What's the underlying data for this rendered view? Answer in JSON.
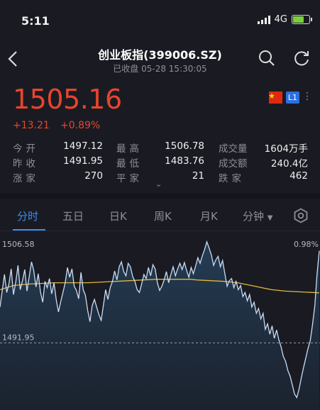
{
  "status": {
    "time": "5:11",
    "network": "4G"
  },
  "header": {
    "title": "创业板指(399006.SZ)",
    "subtitle": "已收盘 05-28 15:30:05"
  },
  "quote": {
    "price": "1505.16",
    "change": "+13.21",
    "change_pct": "+0.89%",
    "market_badge": "L1"
  },
  "stats": [
    [
      {
        "label": "今开",
        "value": "1497.12"
      },
      {
        "label": "最高",
        "value": "1506.78"
      },
      {
        "label": "成交量",
        "value": "1604万手"
      }
    ],
    [
      {
        "label": "昨收",
        "value": "1491.95"
      },
      {
        "label": "最低",
        "value": "1483.76"
      },
      {
        "label": "成交额",
        "value": "240.4亿"
      }
    ],
    [
      {
        "label": "涨家",
        "value": "270"
      },
      {
        "label": "平家",
        "value": "21"
      },
      {
        "label": "跌家",
        "value": "462"
      }
    ]
  ],
  "tabs": [
    "分时",
    "五日",
    "日K",
    "周K",
    "月K",
    "分钟"
  ],
  "active_tab": "分时",
  "chart": {
    "top_label": "1506.58",
    "top_pct": "0.98%",
    "ref_label": "1491.95"
  },
  "chart_data": {
    "type": "line",
    "series": [
      {
        "values": [
          1497.1,
          1499.5,
          1501.8,
          1499.2,
          1500.5,
          1502.6,
          1498.9,
          1500.7,
          1503.1,
          1499.6,
          1500.9,
          1502.5,
          1499.4,
          1501.5,
          1503.6,
          1502.4,
          1500.0,
          1501.9,
          1499.3,
          1497.8,
          1500.8,
          1499.9,
          1501.2,
          1499.0,
          1500.6,
          1498.2,
          1496.4,
          1497.9,
          1499.2,
          1500.6,
          1502.8,
          1501.4,
          1502.6,
          1500.1,
          1499.5,
          1498.3,
          1502.1,
          1499.6,
          1498.8,
          1496.6,
          1495.0,
          1497.3,
          1498.2,
          1497.1,
          1496.0,
          1495.2,
          1497.4,
          1499.6,
          1498.2,
          1499.9,
          1500.8,
          1502.3,
          1501.0,
          1502.9,
          1503.6,
          1502.2,
          1501.6,
          1503.4,
          1502.9,
          1501.5,
          1500.8,
          1499.6,
          1499.2,
          1500.4,
          1501.8,
          1501.2,
          1502.8,
          1501.6,
          1503.2,
          1502.6,
          1500.6,
          1499.5,
          1500.1,
          1501.0,
          1502.2,
          1500.6,
          1501.8,
          1502.9,
          1501.6,
          1502.6,
          1503.4,
          1502.5,
          1503.5,
          1502.4,
          1501.4,
          1502.8,
          1501.9,
          1503.0,
          1504.2,
          1503.4,
          1504.5,
          1505.4,
          1506.5,
          1505.6,
          1504.6,
          1503.1,
          1503.9,
          1504.4,
          1502.9,
          1503.8,
          1501.9,
          1500.1,
          1500.9,
          1501.2,
          1499.9,
          1500.8,
          1499.6,
          1500.2,
          1498.6,
          1499.2,
          1498.0,
          1498.9,
          1497.1,
          1497.8,
          1496.2,
          1496.9,
          1495.4,
          1496.2,
          1493.9,
          1494.7,
          1493.2,
          1494.4,
          1492.6,
          1493.8,
          1492.4,
          1491.4,
          1490.0,
          1489.3,
          1488.0,
          1487.2,
          1485.9,
          1484.6,
          1484.1,
          1485.3,
          1486.9,
          1488.4,
          1489.8,
          1491.2,
          1492.3,
          1494.6,
          1497.3,
          1501.8,
          1505.2
        ]
      },
      {
        "values": [
          1499.6,
          1499.9,
          1500.2,
          1500.3,
          1500.4,
          1500.45,
          1500.5,
          1500.55,
          1500.6,
          1500.6,
          1500.6,
          1500.6,
          1500.6,
          1500.6,
          1500.65,
          1500.7,
          1500.75,
          1500.8,
          1500.85,
          1500.9,
          1500.95,
          1501.0,
          1501.05,
          1501.1,
          1501.1,
          1501.1,
          1501.1,
          1501.1,
          1501.1,
          1501.0,
          1500.95,
          1500.9,
          1500.85,
          1500.8,
          1500.7,
          1500.6,
          1500.4,
          1500.2,
          1500.0,
          1499.8,
          1499.6,
          1499.5,
          1499.4,
          1499.35,
          1499.3,
          1499.25,
          1499.2,
          1499.15
        ]
      }
    ],
    "y_ref": 1491.95,
    "ylim": [
      1482.3,
      1506.58
    ]
  }
}
